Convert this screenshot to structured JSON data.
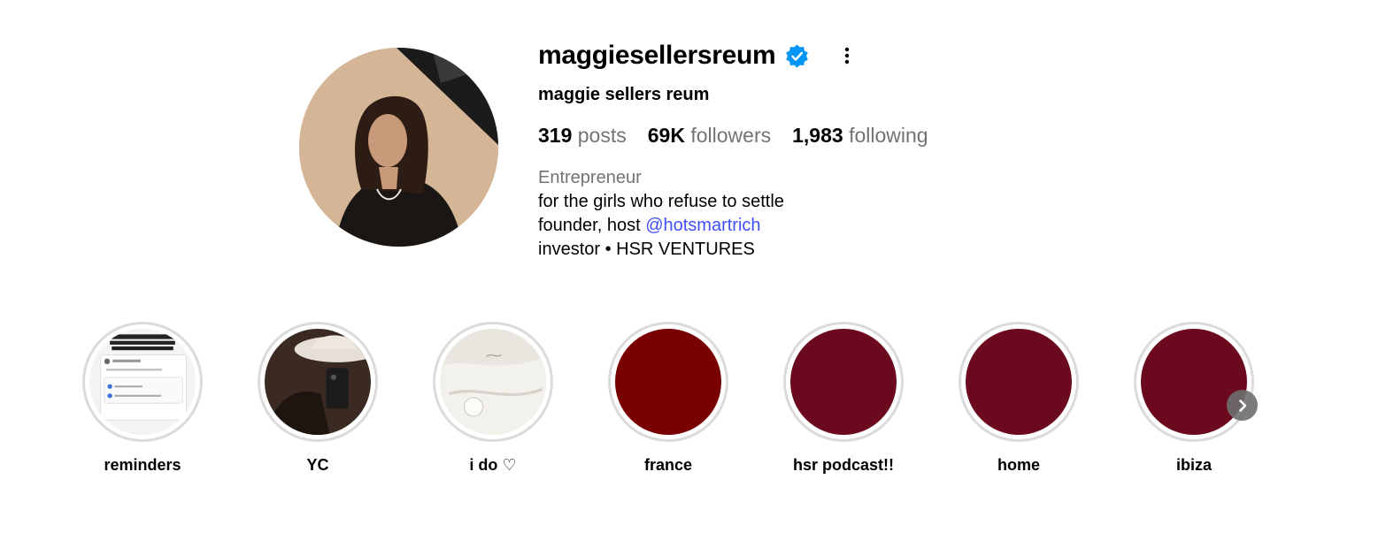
{
  "profile": {
    "username": "maggiesellersreum",
    "full_name": "maggie sellers reum",
    "stats": {
      "posts_count": "319",
      "posts_label": "posts",
      "followers_count": "69K",
      "followers_label": "followers",
      "following_count": "1,983",
      "following_label": "following"
    },
    "bio": {
      "category": "Entrepreneur",
      "line1": "for the girls who refuse to settle",
      "line2_prefix": "founder, host ",
      "line2_link": "@hotsmartrich",
      "line3": "investor • HSR VENTURES"
    }
  },
  "icons": {
    "verified": "verified-badge-icon",
    "more": "more-options-icon",
    "next": "chevron-right-icon"
  },
  "highlights": [
    {
      "label": "reminders",
      "cover": "screenshot"
    },
    {
      "label": "YC",
      "cover": "photo"
    },
    {
      "label": "i do ♡",
      "cover": "photo"
    },
    {
      "label": "france",
      "cover_color": "#7a0000"
    },
    {
      "label": "hsr podcast!!",
      "cover_color": "#6b0a1e"
    },
    {
      "label": "home",
      "cover_color": "#6b0a1e"
    },
    {
      "label": "ibiza",
      "cover_color": "#6b0a1e"
    }
  ],
  "colors": {
    "link": "#4150f7",
    "verified": "#0095f6",
    "muted_text": "#737373",
    "ring": "#dbdbdb"
  }
}
